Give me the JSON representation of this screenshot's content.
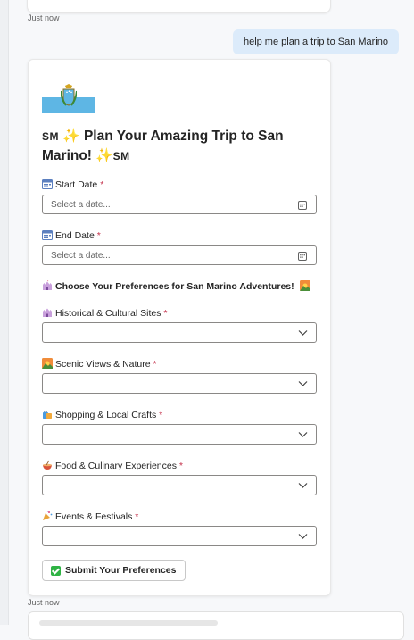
{
  "chat": {
    "prev_timestamp": "Just now",
    "user_message": "help me plan a trip to San Marino",
    "bottom_timestamp": "Just now"
  },
  "card": {
    "title": "Plan Your Amazing Trip to San Marino!",
    "title_flag_text": "SM",
    "start_date": {
      "label": "Start Date",
      "placeholder": "Select a date...",
      "icon": "calendar-icon"
    },
    "end_date": {
      "label": "End Date",
      "placeholder": "Select a date...",
      "icon": "calendar-icon"
    },
    "preferences_heading": "Choose Your Preferences for San Marino Adventures!",
    "selects": [
      {
        "label": "Historical & Cultural Sites",
        "icon": "castle-icon",
        "value": ""
      },
      {
        "label": "Scenic Views & Nature",
        "icon": "sunrise-mountain-icon",
        "value": ""
      },
      {
        "label": "Shopping & Local Crafts",
        "icon": "shopping-bags-icon",
        "value": ""
      },
      {
        "label": "Food & Culinary Experiences",
        "icon": "food-bowl-icon",
        "value": ""
      },
      {
        "label": "Events & Festivals",
        "icon": "party-popper-icon",
        "value": ""
      }
    ],
    "required_marker": "*",
    "submit_label": "Submit Your Preferences"
  },
  "colors": {
    "user_bubble": "#dcebfa",
    "required": "#c4314b",
    "flag_blue": "#5eb6e4",
    "check_green": "#2fb344"
  }
}
